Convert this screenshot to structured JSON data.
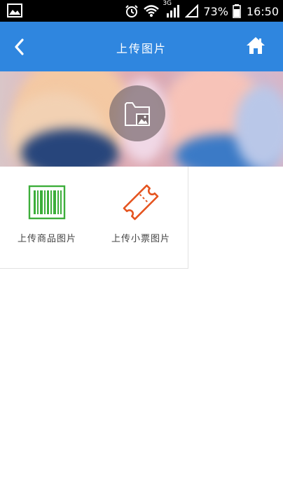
{
  "status_bar": {
    "network": "3G",
    "battery": "73%",
    "time": "16:50"
  },
  "header": {
    "title": "上传图片"
  },
  "tiles": [
    {
      "label": "上传商品图片",
      "icon": "barcode-icon",
      "color": "#3dae3b"
    },
    {
      "label": "上传小票图片",
      "icon": "ticket-icon",
      "color": "#e5541f"
    }
  ],
  "colors": {
    "header_bg": "#2f86df",
    "status_bar_bg": "#000000"
  }
}
